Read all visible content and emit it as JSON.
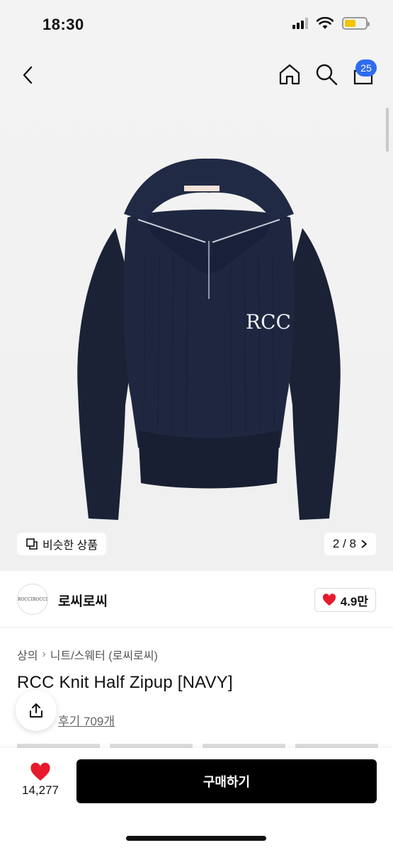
{
  "status_bar": {
    "time": "18:30",
    "icons": [
      "signal-icon",
      "wifi-icon",
      "battery-charging-icon"
    ],
    "battery_level": 0.55,
    "battery_color": "#f2c500"
  },
  "header": {
    "back_icon": "chevron-left-icon",
    "home_icon": "home-icon",
    "search_icon": "search-icon",
    "cart_icon": "cart-icon",
    "cart_count": "25",
    "badge_color": "#2f6bf0"
  },
  "hero": {
    "image_alt": "navy ribbed knit half-zip sweater with RCC logo",
    "logo_text": "RCC",
    "similar_label": "비슷한 상품",
    "page_indicator": "2 / 8"
  },
  "brand": {
    "logo_text": "ROCCIROCCI",
    "name": "로씨로씨",
    "likes": "4.9만",
    "heart_color": "#e8192c"
  },
  "product": {
    "breadcrumb": [
      "상의",
      "니트/스웨터 (로씨로씨)"
    ],
    "title": "RCC Knit Half Zipup [NAVY]",
    "reviews": "후기 709개"
  },
  "bottom_bar": {
    "like_count": "14,277",
    "buy_label": "구매하기"
  }
}
